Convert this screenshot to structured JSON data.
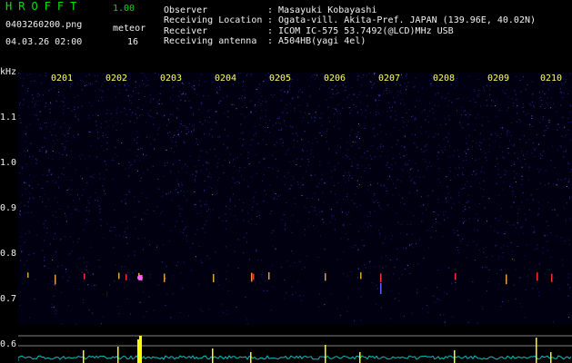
{
  "header": {
    "app_title": "HROFFT",
    "version": "1.00",
    "filename": "0403260200.png",
    "meteor_label": "meteor",
    "timestamp": "04.03.26 02:00",
    "meteor_count": "16"
  },
  "station": {
    "observer_label": "Observer",
    "observer_value": ": Masayuki Kobayashi",
    "location_label": "Receiving Location",
    "location_value": ": Ogata-vill. Akita-Pref. JAPAN (139.96E, 40.02N)",
    "receiver_label": "Receiver",
    "receiver_value": ": ICOM IC-575 53.7492(@LCD)MHz USB",
    "antenna_label": "Receiving antenna",
    "antenna_value": ": A504HB(yagi 4el)"
  },
  "spectrogram": {
    "unit_label": "kHz",
    "time_ticks": [
      "0201",
      "0202",
      "0203",
      "0204",
      "0205",
      "0206",
      "0207",
      "0208",
      "0209",
      "0210"
    ],
    "freq_ticks": [
      "1.1",
      "1.0",
      "0.9",
      "0.8",
      "0.7",
      "0.6"
    ]
  },
  "colors": {
    "background": "#000000",
    "noise": "#2222aa",
    "title_green": "#00e000",
    "tick_yellow": "#ffff60",
    "meteor_red": "#ff3030",
    "trace_cyan": "#00c0c0",
    "spike_yellow": "#ffff00"
  }
}
